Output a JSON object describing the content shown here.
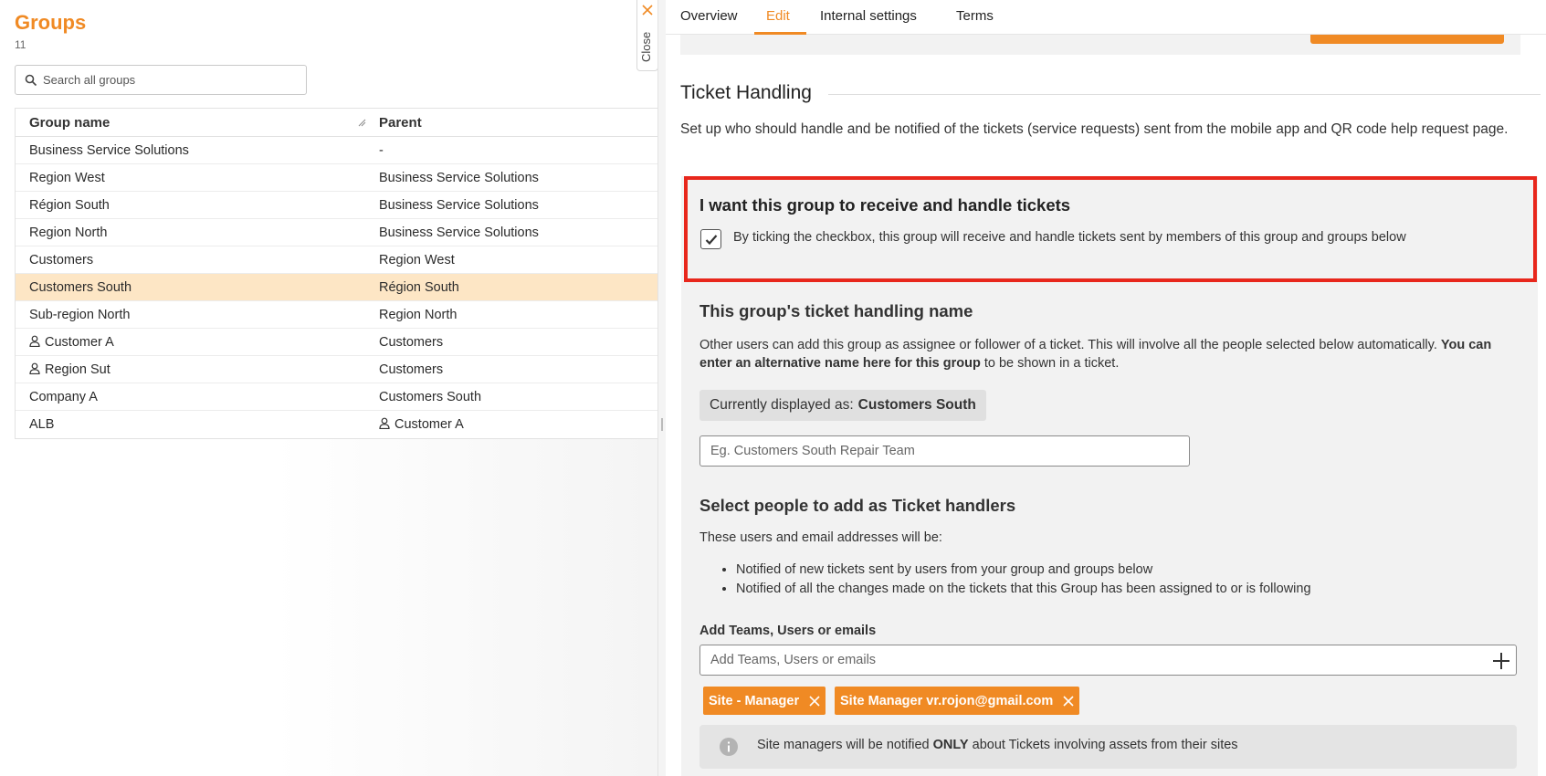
{
  "left_panel": {
    "title": "Groups",
    "count": "11",
    "search_placeholder": "Search all groups",
    "columns": {
      "name": "Group name",
      "parent": "Parent"
    },
    "rows": [
      {
        "name": "Business Service Solutions",
        "parent": "-",
        "name_icon": "",
        "parent_icon": ""
      },
      {
        "name": "Region West",
        "parent": "Business Service Solutions",
        "name_icon": "",
        "parent_icon": ""
      },
      {
        "name": "Région South",
        "parent": "Business Service Solutions",
        "name_icon": "",
        "parent_icon": ""
      },
      {
        "name": "Region North",
        "parent": "Business Service Solutions",
        "name_icon": "",
        "parent_icon": ""
      },
      {
        "name": "Customers",
        "parent": "Region West",
        "name_icon": "",
        "parent_icon": ""
      },
      {
        "name": "Customers South",
        "parent": "Région South",
        "name_icon": "",
        "parent_icon": "",
        "selected": true
      },
      {
        "name": "Sub-region North",
        "parent": "Region North",
        "name_icon": "",
        "parent_icon": ""
      },
      {
        "name": "Customer A",
        "parent": "Customers",
        "name_icon": "person-icon",
        "parent_icon": ""
      },
      {
        "name": "Region Sut",
        "parent": "Customers",
        "name_icon": "person-icon",
        "parent_icon": ""
      },
      {
        "name": "Company A",
        "parent": "Customers South",
        "name_icon": "",
        "parent_icon": ""
      },
      {
        "name": "ALB",
        "parent": "Customer A",
        "name_icon": "",
        "parent_icon": "person-icon"
      }
    ]
  },
  "close_tab": {
    "label": "Close"
  },
  "tabs": [
    {
      "label": "Overview",
      "active": false
    },
    {
      "label": "Edit",
      "active": true
    },
    {
      "label": "Internal settings",
      "active": false
    },
    {
      "label": "Terms",
      "active": false
    }
  ],
  "ticket_handling": {
    "title": "Ticket Handling",
    "description": "Set up who should handle and be notified of the tickets (service requests) sent from the mobile app and QR code help request page.",
    "receive": {
      "title": "I want this group to receive and handle tickets",
      "checkbox_checked": true,
      "checkbox_label": "By ticking the checkbox, this group will receive and handle tickets sent by members of this group and groups below"
    },
    "handling_name": {
      "title": "This group's ticket handling name",
      "desc_plain": "Other users can add this group as assignee or follower of a ticket. This will involve all the people selected below automatically.",
      "desc_bold": "You can enter an alternative name here for this group",
      "desc_tail": "to be shown in a ticket.",
      "currently_label": "Currently displayed as:",
      "currently_value": "Customers South",
      "input_placeholder": "Eg. Customers South Repair Team"
    },
    "handlers": {
      "title": "Select people to add as Ticket handlers",
      "intro": "These users and email addresses will be:",
      "bullets": [
        "Notified of new tickets sent by users from your group and groups below",
        "Notified of all the changes made on the tickets that this Group has been assigned to or is following"
      ],
      "add_label": "Add Teams, Users or emails",
      "add_placeholder": "Add Teams, Users or emails",
      "chips": [
        "Site - Manager",
        "Site Manager vr.rojon@gmail.com"
      ],
      "info_prefix": "Site managers will be notified",
      "info_bold": "ONLY",
      "info_suffix": "about Tickets involving assets from their sites"
    }
  },
  "colors": {
    "accent": "#f08a24",
    "highlight_border": "#e8271c",
    "selected_row": "#fde6c5"
  }
}
